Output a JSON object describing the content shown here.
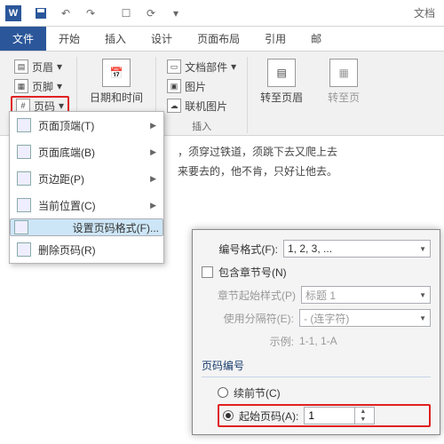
{
  "title_suffix": "文档",
  "tabs": {
    "file": "文件",
    "home": "开始",
    "insert": "插入",
    "design": "设计",
    "layout": "页面布局",
    "ref": "引用",
    "mail": "邮"
  },
  "ribbon": {
    "header": "页眉",
    "footer": "页脚",
    "pagenum": "页码",
    "datetime": "日期和时间",
    "parts": "文档部件",
    "picture": "图片",
    "online": "联机图片",
    "goto_header": "转至页眉",
    "goto_footer": "转至页",
    "insert_group": "插入"
  },
  "dropdown": {
    "top": "页面顶端(T)",
    "bottom": "页面底端(B)",
    "margins": "页边距(P)",
    "current": "当前位置(C)",
    "format": "设置页码格式(F)...",
    "remove": "删除页码(R)"
  },
  "doc_lines": {
    "l1": "，须穿过铁道，须跳下去又爬上去",
    "l2": "来要去的，他不肯，只好让他去。"
  },
  "dlg": {
    "format_label": "编号格式(F):",
    "format_value": "1, 2, 3, ...",
    "include_chapter": "包含章节号(N)",
    "chapter_style_label": "章节起始样式(P)",
    "chapter_style_value": "标题 1",
    "separator_label": "使用分隔符(E):",
    "separator_value": "- (连字符)",
    "example_label": "示例:",
    "example_value": "1-1, 1-A",
    "numbering": "页码编号",
    "continue": "续前节(C)",
    "start_at": "起始页码(A):",
    "start_value": "1"
  }
}
